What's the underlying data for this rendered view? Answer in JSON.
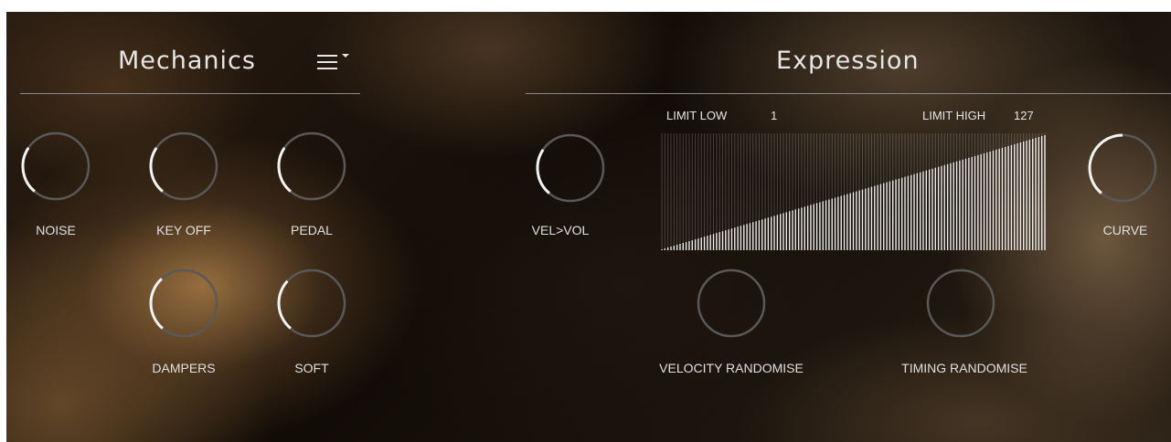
{
  "mechanics": {
    "title": "Mechanics",
    "menu_icon": "menu-dropdown-icon",
    "knobs": [
      {
        "id": "noise",
        "label": "NOISE",
        "value": 0.3
      },
      {
        "id": "key-off",
        "label": "KEY OFF",
        "value": 0.3
      },
      {
        "id": "pedal",
        "label": "PEDAL",
        "value": 0.3
      },
      {
        "id": "dampers",
        "label": "DAMPERS",
        "value": 0.35
      },
      {
        "id": "soft",
        "label": "SOFT",
        "value": 0.33
      }
    ]
  },
  "expression": {
    "title": "Expression",
    "limit_low_label": "LIMIT LOW",
    "limit_low_value": "1",
    "limit_high_label": "LIMIT HIGH",
    "limit_high_value": "127",
    "curve_bars": 127,
    "knobs": [
      {
        "id": "vel-vol",
        "label": "VEL>VOL",
        "value": 0.3
      },
      {
        "id": "curve",
        "label": "CURVE",
        "value": 0.5
      },
      {
        "id": "velocity-randomise",
        "label": "VELOCITY RANDOMISE",
        "value": 0.0
      },
      {
        "id": "timing-randomise",
        "label": "TIMING RANDOMISE",
        "value": 0.0
      }
    ]
  },
  "colors": {
    "knob_ring": "#595959",
    "knob_arc": "#f2f2f2",
    "text": "#e6e6e6"
  }
}
